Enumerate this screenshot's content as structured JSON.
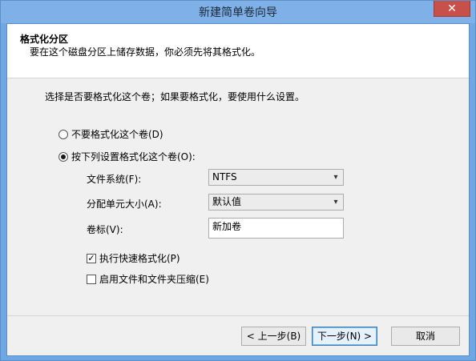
{
  "window": {
    "title": "新建简单卷向导",
    "close_symbol": "✕"
  },
  "header": {
    "title": "格式化分区",
    "subtitle": "要在这个磁盘分区上储存数据，你必须先将其格式化。"
  },
  "intro": "选择是否要格式化这个卷；如果要格式化，要使用什么设置。",
  "options": {
    "no_format": {
      "label": "不要格式化这个卷(D)",
      "checked": false
    },
    "format": {
      "label": "按下列设置格式化这个卷(O):",
      "checked": true
    }
  },
  "fields": {
    "filesystem": {
      "label": "文件系统(F):",
      "value": "NTFS"
    },
    "alloc_size": {
      "label": "分配单元大小(A):",
      "value": "默认值"
    },
    "volume_label": {
      "label": "卷标(V):",
      "value": "新加卷"
    }
  },
  "checkboxes": {
    "quick_format": {
      "label": "执行快速格式化(P)",
      "checked": true,
      "mark": "✓"
    },
    "compression": {
      "label": "启用文件和文件夹压缩(E)",
      "checked": false,
      "mark": ""
    }
  },
  "buttons": {
    "back": "< 上一步(B)",
    "next": "下一步(N) >",
    "cancel": "取消"
  },
  "icons": {
    "dropdown": "chevron-down-icon",
    "arrow_symbol": "▾"
  }
}
